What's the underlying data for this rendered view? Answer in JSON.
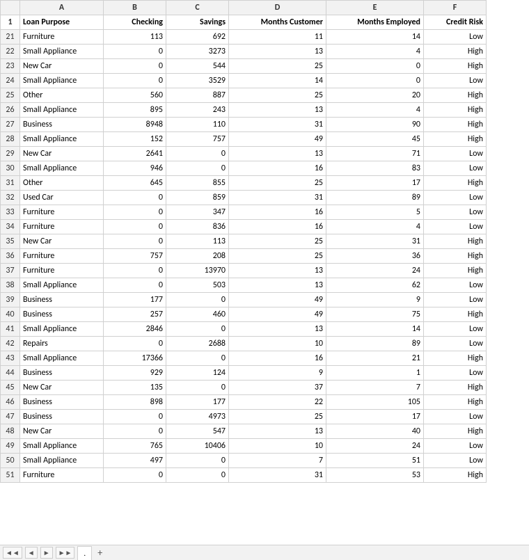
{
  "columns": {
    "rownum": "",
    "A": "A",
    "B": "B",
    "C": "C",
    "D": "D",
    "E": "E",
    "F": "F"
  },
  "header": {
    "rownum": "1",
    "A": "Loan Purpose",
    "B": "Checking",
    "C": "Savings",
    "D": "Months Customer",
    "E": "Months Employed",
    "F": "Credit Risk"
  },
  "rows": [
    {
      "num": "21",
      "A": "Furniture",
      "B": "113",
      "C": "692",
      "D": "11",
      "E": "14",
      "F": "Low"
    },
    {
      "num": "22",
      "A": "Small Appliance",
      "B": "0",
      "C": "3273",
      "D": "13",
      "E": "4",
      "F": "High"
    },
    {
      "num": "23",
      "A": "New Car",
      "B": "0",
      "C": "544",
      "D": "25",
      "E": "0",
      "F": "High"
    },
    {
      "num": "24",
      "A": "Small Appliance",
      "B": "0",
      "C": "3529",
      "D": "14",
      "E": "0",
      "F": "Low"
    },
    {
      "num": "25",
      "A": "Other",
      "B": "560",
      "C": "887",
      "D": "25",
      "E": "20",
      "F": "High"
    },
    {
      "num": "26",
      "A": "Small Appliance",
      "B": "895",
      "C": "243",
      "D": "13",
      "E": "4",
      "F": "High"
    },
    {
      "num": "27",
      "A": "Business",
      "B": "8948",
      "C": "110",
      "D": "31",
      "E": "90",
      "F": "High"
    },
    {
      "num": "28",
      "A": "Small Appliance",
      "B": "152",
      "C": "757",
      "D": "49",
      "E": "45",
      "F": "High"
    },
    {
      "num": "29",
      "A": "New Car",
      "B": "2641",
      "C": "0",
      "D": "13",
      "E": "71",
      "F": "Low"
    },
    {
      "num": "30",
      "A": "Small Appliance",
      "B": "946",
      "C": "0",
      "D": "16",
      "E": "83",
      "F": "Low"
    },
    {
      "num": "31",
      "A": "Other",
      "B": "645",
      "C": "855",
      "D": "25",
      "E": "17",
      "F": "High"
    },
    {
      "num": "32",
      "A": "Used Car",
      "B": "0",
      "C": "859",
      "D": "31",
      "E": "89",
      "F": "Low"
    },
    {
      "num": "33",
      "A": "Furniture",
      "B": "0",
      "C": "347",
      "D": "16",
      "E": "5",
      "F": "Low"
    },
    {
      "num": "34",
      "A": "Furniture",
      "B": "0",
      "C": "836",
      "D": "16",
      "E": "4",
      "F": "Low"
    },
    {
      "num": "35",
      "A": "New Car",
      "B": "0",
      "C": "113",
      "D": "25",
      "E": "31",
      "F": "High"
    },
    {
      "num": "36",
      "A": "Furniture",
      "B": "757",
      "C": "208",
      "D": "25",
      "E": "36",
      "F": "High"
    },
    {
      "num": "37",
      "A": "Furniture",
      "B": "0",
      "C": "13970",
      "D": "13",
      "E": "24",
      "F": "High"
    },
    {
      "num": "38",
      "A": "Small Appliance",
      "B": "0",
      "C": "503",
      "D": "13",
      "E": "62",
      "F": "Low"
    },
    {
      "num": "39",
      "A": "Business",
      "B": "177",
      "C": "0",
      "D": "49",
      "E": "9",
      "F": "Low"
    },
    {
      "num": "40",
      "A": "Business",
      "B": "257",
      "C": "460",
      "D": "49",
      "E": "75",
      "F": "High"
    },
    {
      "num": "41",
      "A": "Small Appliance",
      "B": "2846",
      "C": "0",
      "D": "13",
      "E": "14",
      "F": "Low"
    },
    {
      "num": "42",
      "A": "Repairs",
      "B": "0",
      "C": "2688",
      "D": "10",
      "E": "89",
      "F": "Low"
    },
    {
      "num": "43",
      "A": "Small Appliance",
      "B": "17366",
      "C": "0",
      "D": "16",
      "E": "21",
      "F": "High"
    },
    {
      "num": "44",
      "A": "Business",
      "B": "929",
      "C": "124",
      "D": "9",
      "E": "1",
      "F": "Low"
    },
    {
      "num": "45",
      "A": "New Car",
      "B": "135",
      "C": "0",
      "D": "37",
      "E": "7",
      "F": "High"
    },
    {
      "num": "46",
      "A": "Business",
      "B": "898",
      "C": "177",
      "D": "22",
      "E": "105",
      "F": "High"
    },
    {
      "num": "47",
      "A": "Business",
      "B": "0",
      "C": "4973",
      "D": "25",
      "E": "17",
      "F": "Low"
    },
    {
      "num": "48",
      "A": "New Car",
      "B": "0",
      "C": "547",
      "D": "13",
      "E": "40",
      "F": "High"
    },
    {
      "num": "49",
      "A": "Small Appliance",
      "B": "765",
      "C": "10406",
      "D": "10",
      "E": "24",
      "F": "Low"
    },
    {
      "num": "50",
      "A": "Small Appliance",
      "B": "497",
      "C": "0",
      "D": "7",
      "E": "51",
      "F": "Low"
    },
    {
      "num": "51",
      "A": "Furniture",
      "B": "0",
      "C": "0",
      "D": "31",
      "E": "53",
      "F": "High"
    }
  ],
  "bottom": {
    "nav_left_left": "◄◄",
    "nav_left": "◄",
    "nav_right": "►",
    "nav_right_right": "►►",
    "tab_name": ".",
    "add_label": "+"
  }
}
